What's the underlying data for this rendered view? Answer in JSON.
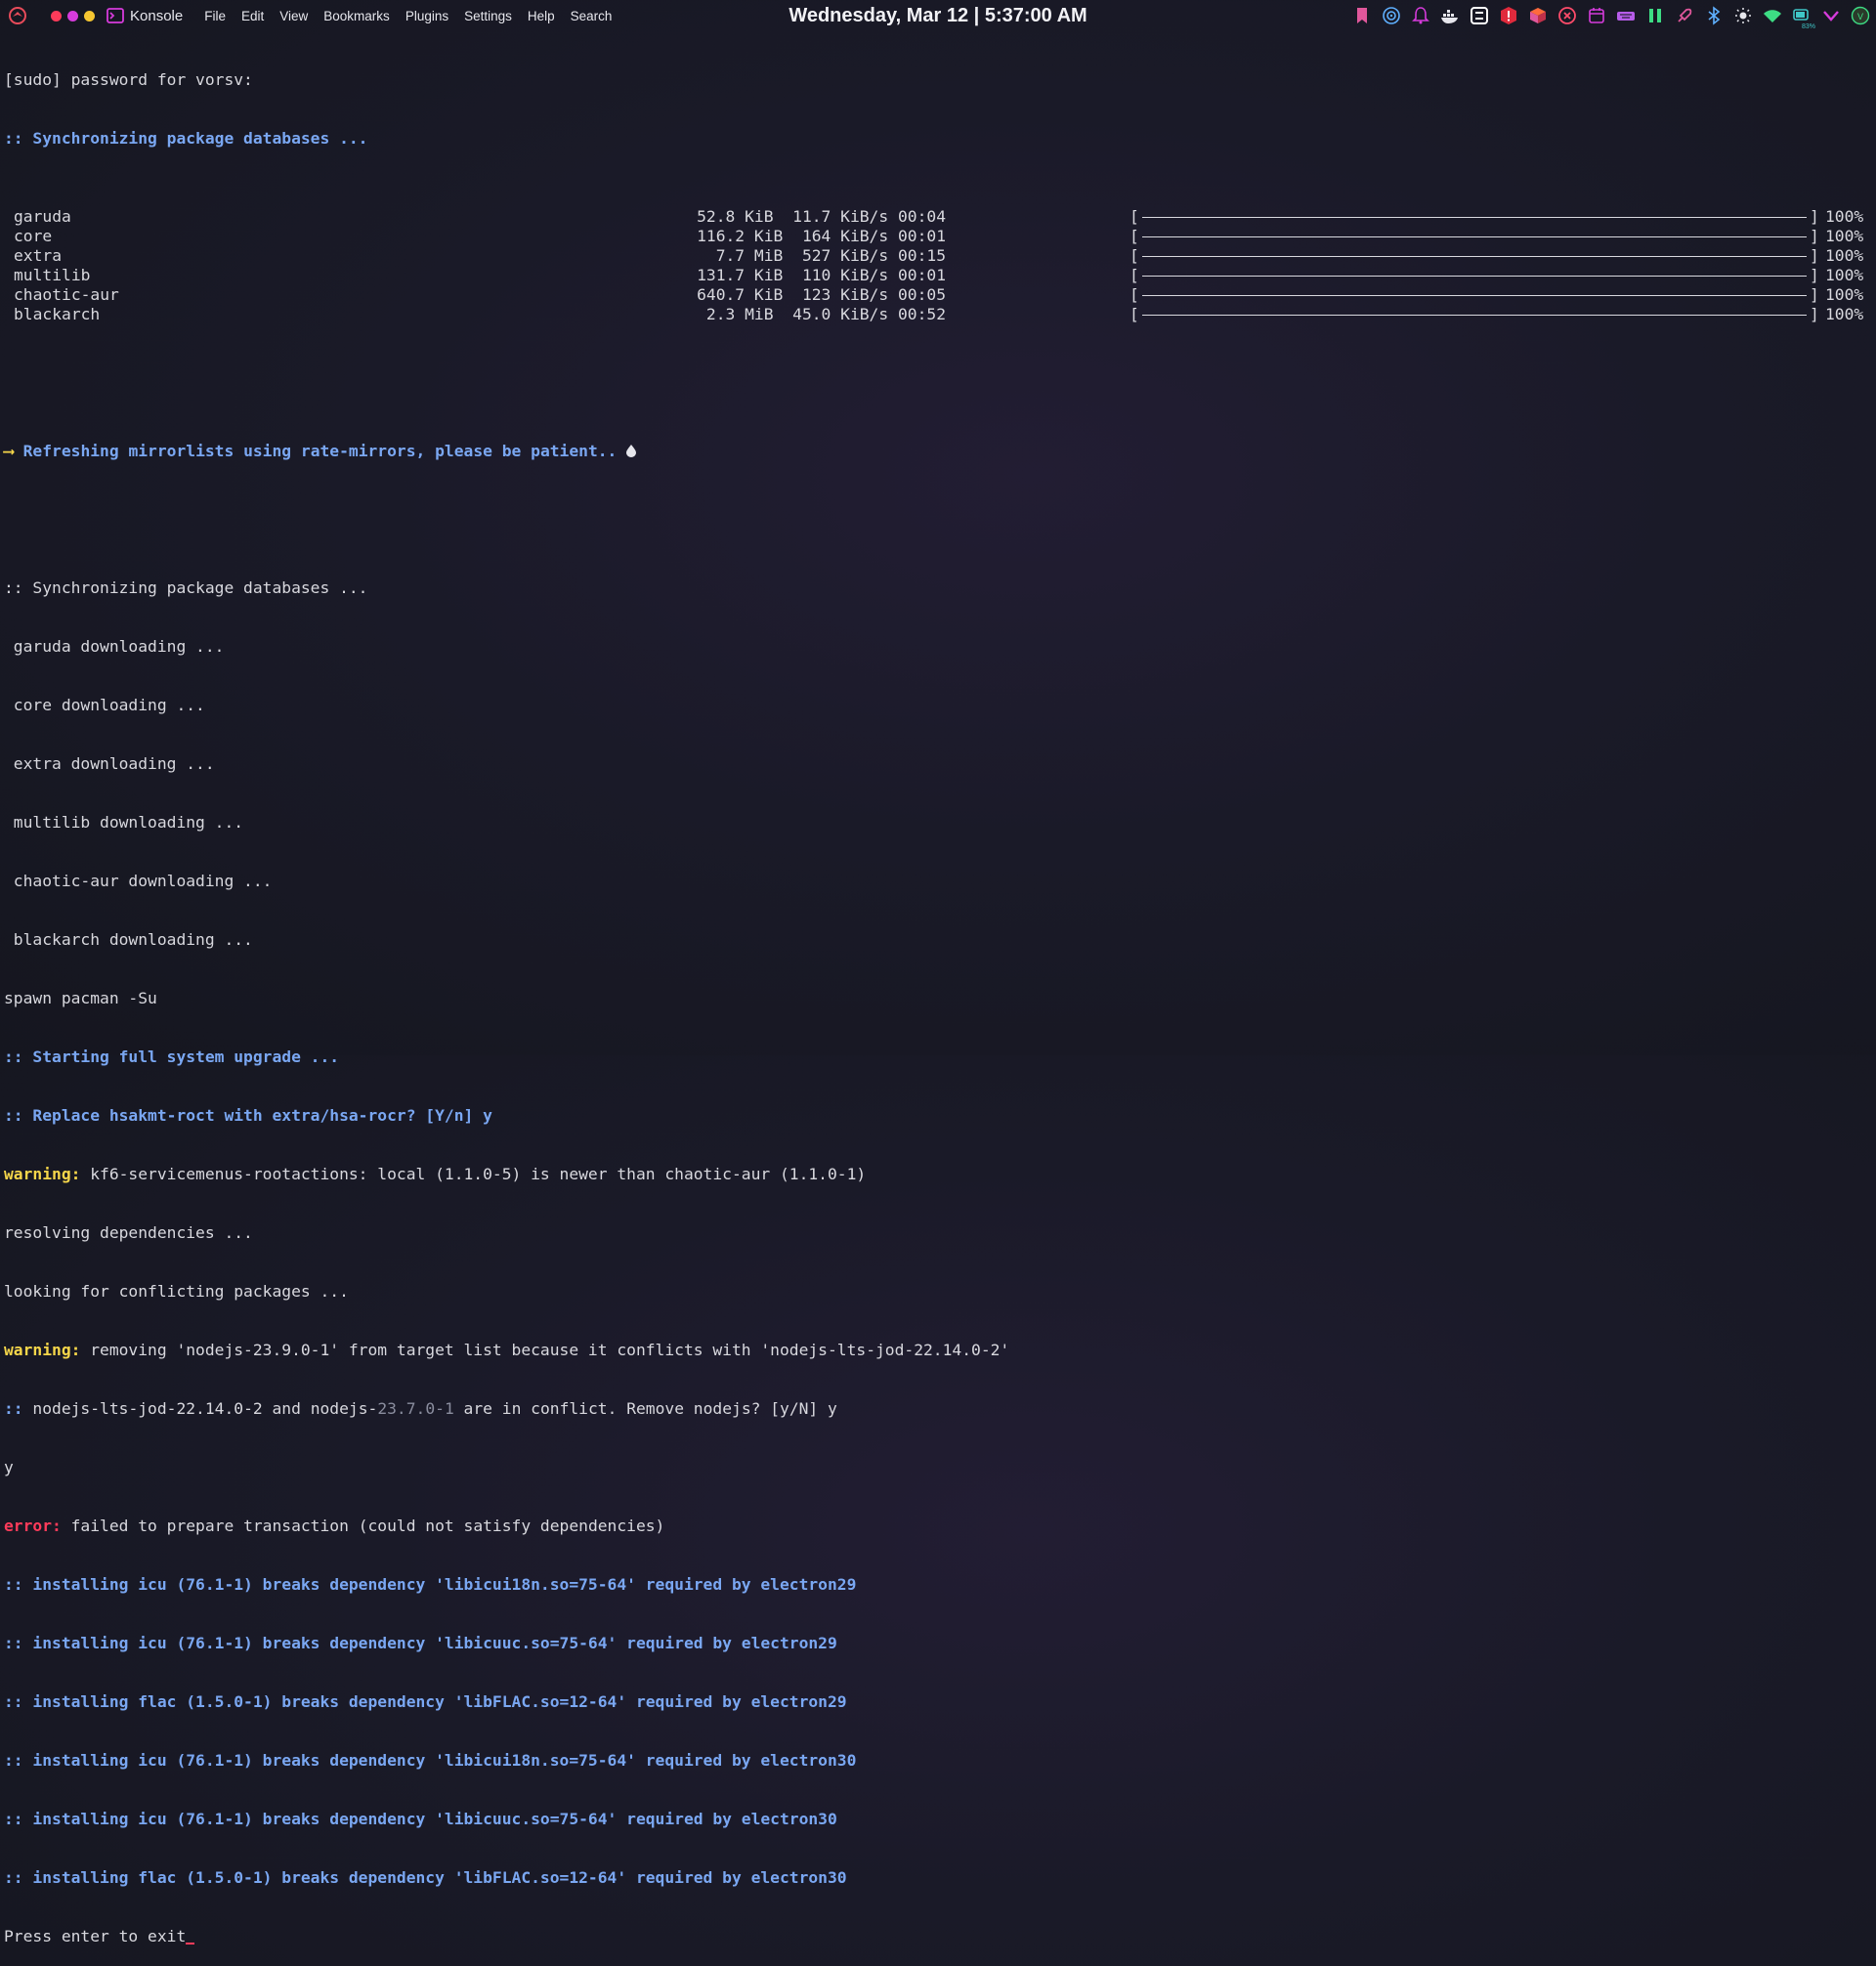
{
  "topbar": {
    "app_name": "Konsole",
    "menu": [
      "File",
      "Edit",
      "View",
      "Bookmarks",
      "Plugins",
      "Settings",
      "Help",
      "Search"
    ],
    "clock": "Wednesday, Mar 12 | 5:37:00 AM",
    "window_dot_colors": [
      "#ff3b5a",
      "#d63bdb",
      "#f6c631"
    ],
    "tray_battery": "83%"
  },
  "terminal": {
    "line_sudo": "[sudo] password for vorsv:",
    "line_sync1": ":: Synchronizing package databases ...",
    "sync_rows": [
      {
        "name": "garuda",
        "size": "52.8 KiB",
        "speed": "11.7 KiB/s",
        "time": "00:04",
        "percent": "100%"
      },
      {
        "name": "core",
        "size": "116.2 KiB",
        "speed": "164 KiB/s",
        "time": "00:01",
        "percent": "100%"
      },
      {
        "name": "extra",
        "size": "7.7 MiB",
        "speed": "527 KiB/s",
        "time": "00:15",
        "percent": "100%"
      },
      {
        "name": "multilib",
        "size": "131.7 KiB",
        "speed": "110 KiB/s",
        "time": "00:01",
        "percent": "100%"
      },
      {
        "name": "chaotic-aur",
        "size": "640.7 KiB",
        "speed": "123 KiB/s",
        "time": "00:05",
        "percent": "100%"
      },
      {
        "name": "blackarch",
        "size": "2.3 MiB",
        "speed": "45.0 KiB/s",
        "time": "00:52",
        "percent": "100%"
      }
    ],
    "refresh_arrow": "⟶",
    "refresh_text": "Refreshing mirrorlists using rate-mirrors, please be patient..",
    "line_sync2": ":: Synchronizing package databases ...",
    "downloading": [
      " garuda downloading ...",
      " core downloading ...",
      " extra downloading ...",
      " multilib downloading ...",
      " chaotic-aur downloading ...",
      " blackarch downloading ..."
    ],
    "line_spawn": "spawn pacman -Su",
    "line_starting": ":: Starting full system upgrade ...",
    "line_replace": ":: Replace hsakmt-roct with extra/hsa-rocr? [Y/n] y",
    "warning_label": "warning:",
    "warning1_text": " kf6-servicemenus-rootactions: local (1.1.0-5) is newer than chaotic-aur (1.1.0-1)",
    "line_resolving": "resolving dependencies ...",
    "line_looking": "looking for conflicting packages ...",
    "warning2_text": " removing 'nodejs-23.9.0-1' from target list because it conflicts with 'nodejs-lts-jod-22.14.0-2'",
    "conflict_prefix": ":: ",
    "conflict_pkg1": "nodejs-lts-jod-22.14.0-2",
    "conflict_mid": " and nodejs-",
    "conflict_ver": "23.7.0-1",
    "conflict_suffix": " are in conflict. Remove nodejs? [y/N] y",
    "line_y": "y",
    "error_label": "error:",
    "error_text": " failed to prepare transaction (could not satisfy dependencies)",
    "breaks": [
      ":: installing icu (76.1-1) breaks dependency 'libicui18n.so=75-64' required by electron29",
      ":: installing icu (76.1-1) breaks dependency 'libicuuc.so=75-64' required by electron29",
      ":: installing flac (1.5.0-1) breaks dependency 'libFLAC.so=12-64' required by electron29",
      ":: installing icu (76.1-1) breaks dependency 'libicui18n.so=75-64' required by electron30",
      ":: installing icu (76.1-1) breaks dependency 'libicuuc.so=75-64' required by electron30",
      ":: installing flac (1.5.0-1) breaks dependency 'libFLAC.so=12-64' required by electron30"
    ],
    "line_press": "Press enter to exit"
  }
}
